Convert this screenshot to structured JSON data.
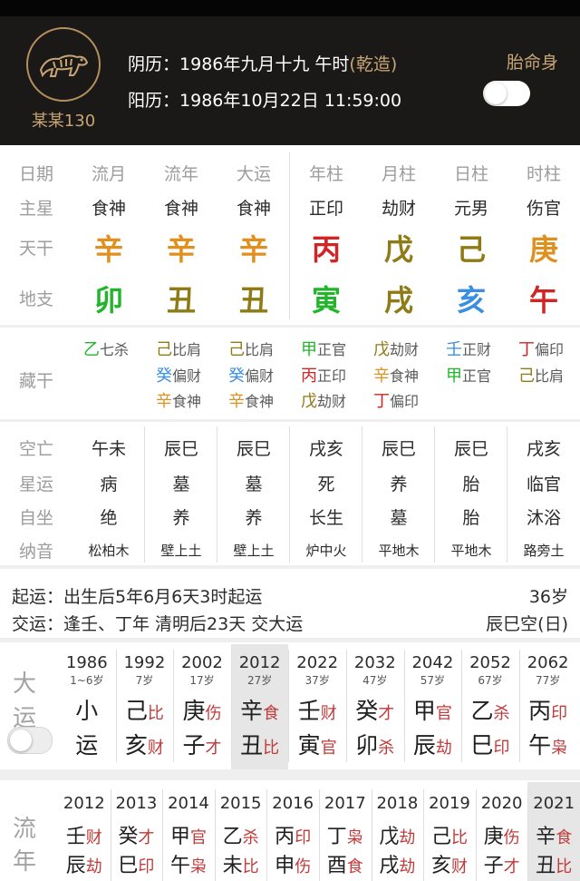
{
  "header": {
    "username": "某某130",
    "lunar_label": "阴历：",
    "lunar_value": "1986年九月十九 午时",
    "qianzao": "(乾造)",
    "solar_label": "阳历：",
    "solar_value": "1986年10月22日 11:59:00",
    "taimingshen": "胎命身"
  },
  "pillars": {
    "row_labels": [
      "日期",
      "主星",
      "天干",
      "地支"
    ],
    "columns": [
      {
        "name": "流月",
        "star": "食神",
        "stem": "辛",
        "stem_color": "#e0901f",
        "branch": "卯",
        "branch_color": "#21b529"
      },
      {
        "name": "流年",
        "star": "食神",
        "stem": "辛",
        "stem_color": "#e0901f",
        "branch": "丑",
        "branch_color": "#8f7b16"
      },
      {
        "name": "大运",
        "star": "食神",
        "stem": "辛",
        "stem_color": "#e0901f",
        "branch": "丑",
        "branch_color": "#8f7b16"
      },
      {
        "name": "年柱",
        "star": "正印",
        "stem": "丙",
        "stem_color": "#d12424",
        "branch": "寅",
        "branch_color": "#21b529"
      },
      {
        "name": "月柱",
        "star": "劫财",
        "stem": "戊",
        "stem_color": "#8f7b16",
        "branch": "戌",
        "branch_color": "#8f7b16"
      },
      {
        "name": "日柱",
        "star": "元男",
        "stem": "己",
        "stem_color": "#8f7b16",
        "branch": "亥",
        "branch_color": "#3b8fe0"
      },
      {
        "name": "时柱",
        "star": "伤官",
        "stem": "庚",
        "stem_color": "#e0901f",
        "branch": "午",
        "branch_color": "#d12424"
      }
    ]
  },
  "canggan": {
    "label": "藏干",
    "columns": [
      [
        {
          "g": "乙",
          "c": "#21b529",
          "s": "七杀"
        }
      ],
      [
        {
          "g": "己",
          "c": "#8f7b16",
          "s": "比肩"
        },
        {
          "g": "癸",
          "c": "#3b8fe0",
          "s": "偏财"
        },
        {
          "g": "辛",
          "c": "#e0901f",
          "s": "食神"
        }
      ],
      [
        {
          "g": "己",
          "c": "#8f7b16",
          "s": "比肩"
        },
        {
          "g": "癸",
          "c": "#3b8fe0",
          "s": "偏财"
        },
        {
          "g": "辛",
          "c": "#e0901f",
          "s": "食神"
        }
      ],
      [
        {
          "g": "甲",
          "c": "#21b529",
          "s": "正官"
        },
        {
          "g": "丙",
          "c": "#d12424",
          "s": "正印"
        },
        {
          "g": "戊",
          "c": "#8f7b16",
          "s": "劫财"
        }
      ],
      [
        {
          "g": "戊",
          "c": "#8f7b16",
          "s": "劫财"
        },
        {
          "g": "辛",
          "c": "#e0901f",
          "s": "食神"
        },
        {
          "g": "丁",
          "c": "#d12424",
          "s": "偏印"
        }
      ],
      [
        {
          "g": "壬",
          "c": "#3b8fe0",
          "s": "正财"
        },
        {
          "g": "甲",
          "c": "#21b529",
          "s": "正官"
        }
      ],
      [
        {
          "g": "丁",
          "c": "#d12424",
          "s": "偏印"
        },
        {
          "g": "己",
          "c": "#8f7b16",
          "s": "比肩"
        }
      ]
    ]
  },
  "attributes": {
    "labels": [
      "空亡",
      "星运",
      "自坐",
      "纳音"
    ],
    "columns": [
      [
        "午未",
        "病",
        "绝",
        "松柏木"
      ],
      [
        "辰巳",
        "墓",
        "养",
        "壁上土"
      ],
      [
        "辰巳",
        "墓",
        "养",
        "壁上土"
      ],
      [
        "戌亥",
        "死",
        "长生",
        "炉中火"
      ],
      [
        "辰巳",
        "养",
        "墓",
        "平地木"
      ],
      [
        "辰巳",
        "胎",
        "胎",
        "平地木"
      ],
      [
        "戌亥",
        "临官",
        "沐浴",
        "路旁土"
      ]
    ]
  },
  "info": {
    "qiyun": "起运：出生后5年6月6天3时起运",
    "age": "36岁",
    "jiaoyun": "交运：逢壬、丁年 清明后23天 交大运",
    "kong": "辰巳空(日)"
  },
  "dayun": {
    "label": [
      "大",
      "运"
    ],
    "items": [
      {
        "year": "1986",
        "age": "1~6岁",
        "top": "小",
        "bottom": "运",
        "tc": "#202020",
        "bc": "#202020",
        "ts": "",
        "bs": ""
      },
      {
        "year": "1992",
        "age": "7岁",
        "top": "己",
        "ts": "比",
        "bottom": "亥",
        "bs": "财"
      },
      {
        "year": "2002",
        "age": "17岁",
        "top": "庚",
        "ts": "伤",
        "bottom": "子",
        "bs": "才"
      },
      {
        "year": "2012",
        "age": "27岁",
        "top": "辛",
        "ts": "食",
        "bottom": "丑",
        "bs": "比"
      },
      {
        "year": "2022",
        "age": "37岁",
        "top": "壬",
        "ts": "财",
        "bottom": "寅",
        "bs": "官"
      },
      {
        "year": "2032",
        "age": "47岁",
        "top": "癸",
        "ts": "才",
        "bottom": "卯",
        "bs": "杀"
      },
      {
        "year": "2042",
        "age": "57岁",
        "top": "甲",
        "ts": "官",
        "bottom": "辰",
        "bs": "劫"
      },
      {
        "year": "2052",
        "age": "67岁",
        "top": "乙",
        "ts": "杀",
        "bottom": "巳",
        "bs": "印"
      },
      {
        "year": "2062",
        "age": "77岁",
        "top": "丙",
        "ts": "印",
        "bottom": "午",
        "bs": "枭"
      }
    ]
  },
  "liunian": {
    "label": [
      "流",
      "年"
    ],
    "items": [
      {
        "year": "2012",
        "top": "壬",
        "ts": "财",
        "bottom": "辰",
        "bs": "劫"
      },
      {
        "year": "2013",
        "top": "癸",
        "ts": "才",
        "bottom": "巳",
        "bs": "印"
      },
      {
        "year": "2014",
        "top": "甲",
        "ts": "官",
        "bottom": "午",
        "bs": "枭"
      },
      {
        "year": "2015",
        "top": "乙",
        "ts": "杀",
        "bottom": "未",
        "bs": "比"
      },
      {
        "year": "2016",
        "top": "丙",
        "ts": "印",
        "bottom": "申",
        "bs": "伤"
      },
      {
        "year": "2017",
        "top": "丁",
        "ts": "枭",
        "bottom": "酉",
        "bs": "食"
      },
      {
        "year": "2018",
        "top": "戊",
        "ts": "劫",
        "bottom": "戌",
        "bs": "劫"
      },
      {
        "year": "2019",
        "top": "己",
        "ts": "比",
        "bottom": "亥",
        "bs": "财"
      },
      {
        "year": "2020",
        "top": "庚",
        "ts": "伤",
        "bottom": "子",
        "bs": "才"
      },
      {
        "year": "2021",
        "top": "辛",
        "ts": "食",
        "bottom": "丑",
        "bs": "比"
      }
    ]
  }
}
